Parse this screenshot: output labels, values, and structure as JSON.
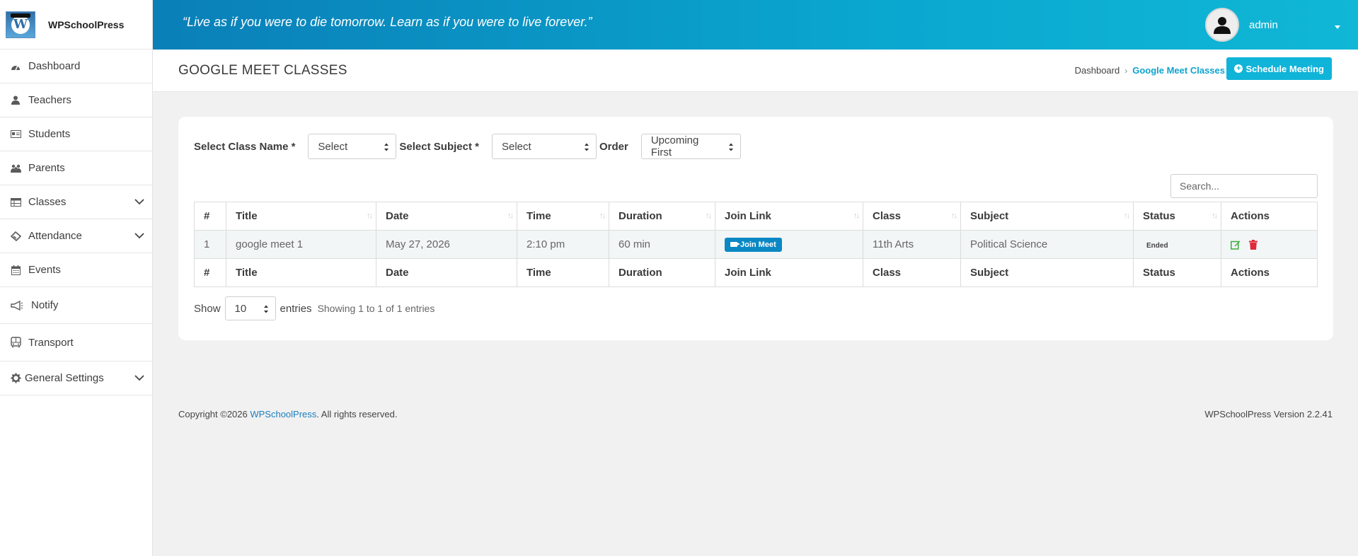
{
  "brand": {
    "name": "WPSchoolPress"
  },
  "sidebar": {
    "items": [
      {
        "label": "Dashboard",
        "icon": "dashboard-icon",
        "expandable": false
      },
      {
        "label": "Teachers",
        "icon": "teacher-icon",
        "expandable": false
      },
      {
        "label": "Students",
        "icon": "student-card-icon",
        "expandable": false
      },
      {
        "label": "Parents",
        "icon": "parents-icon",
        "expandable": false
      },
      {
        "label": "Classes",
        "icon": "classes-icon",
        "expandable": true
      },
      {
        "label": "Attendance",
        "icon": "attendance-icon",
        "expandable": true
      },
      {
        "label": "Events",
        "icon": "calendar-icon",
        "expandable": false
      },
      {
        "label": "Notify",
        "icon": "megaphone-icon",
        "expandable": false
      },
      {
        "label": "Transport",
        "icon": "bus-icon",
        "expandable": false
      },
      {
        "label": "General Settings",
        "icon": "gear-icon",
        "expandable": true
      }
    ]
  },
  "header": {
    "quote": "“Live as if you were to die tomorrow. Learn as if you were to live forever.”",
    "user_name": "admin"
  },
  "page": {
    "title": "GOOGLE MEET CLASSES",
    "breadcrumb": [
      "Dashboard",
      "Google Meet Classes"
    ],
    "schedule_button": "Schedule Meeting"
  },
  "filters": {
    "class_label": "Select Class Name *",
    "class_value": "Select",
    "subject_label": "Select Subject *",
    "subject_value": "Select",
    "order_label": "Order",
    "order_value": "Upcoming First"
  },
  "search": {
    "placeholder": "Search..."
  },
  "table": {
    "columns": [
      "#",
      "Title",
      "Date",
      "Time",
      "Duration",
      "Join Link",
      "Class",
      "Subject",
      "Status",
      "Actions"
    ],
    "rows": [
      {
        "num": "1",
        "title": "google meet 1",
        "date": "May 27, 2026",
        "time": "2:10 pm",
        "duration": "60 min",
        "join_label": "Join Meet",
        "class": "11th Arts",
        "subject": "Political Science",
        "status": "Ended"
      }
    ]
  },
  "pagination": {
    "show_label": "Show",
    "page_size": "10",
    "entries_label": "entries",
    "info": "Showing 1 to 1 of 1 entries"
  },
  "footer": {
    "copyright_prefix": "Copyright ©2026 ",
    "copyright_link": "WPSchoolPress",
    "copyright_suffix": ". All rights reserved.",
    "version": "WPSchoolPress Version 2.2.41"
  },
  "colors": {
    "accent": "#10b4d9",
    "header_gradient_start": "#0a7fb8",
    "join_button": "#0a88c4",
    "edit_icon": "#3cab3c",
    "delete_icon": "#e0293a"
  }
}
